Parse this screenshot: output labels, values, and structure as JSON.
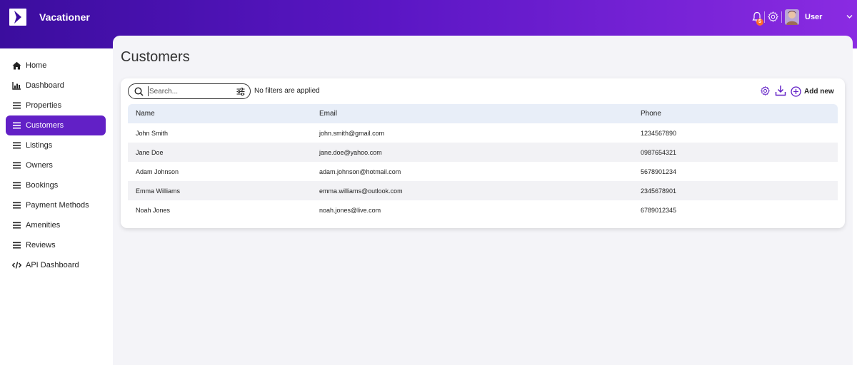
{
  "app": {
    "title": "Vacationer",
    "logo_icon": "chevron-right-logo"
  },
  "header": {
    "notification_count": "5",
    "user_name": "User",
    "accent": "#5a16c4"
  },
  "sidebar": {
    "items": [
      {
        "label": "Home",
        "icon": "home-icon",
        "active": false
      },
      {
        "label": "Dashboard",
        "icon": "bar-chart-icon",
        "active": false
      },
      {
        "label": "Properties",
        "icon": "list-icon",
        "active": false
      },
      {
        "label": "Customers",
        "icon": "list-icon",
        "active": true
      },
      {
        "label": "Listings",
        "icon": "list-icon",
        "active": false
      },
      {
        "label": "Owners",
        "icon": "list-icon",
        "active": false
      },
      {
        "label": "Bookings",
        "icon": "list-icon",
        "active": false
      },
      {
        "label": "Payment Methods",
        "icon": "list-icon",
        "active": false
      },
      {
        "label": "Amenities",
        "icon": "list-icon",
        "active": false
      },
      {
        "label": "Reviews",
        "icon": "list-icon",
        "active": false
      },
      {
        "label": "API Dashboard",
        "icon": "code-icon",
        "active": false
      }
    ]
  },
  "main": {
    "page_title": "Customers",
    "search": {
      "placeholder": "Search...",
      "value": ""
    },
    "filter_status": "No filters are applied",
    "add_new_label": "Add new",
    "table": {
      "columns": [
        "Name",
        "Email",
        "Phone"
      ],
      "rows": [
        {
          "name": "John Smith",
          "email": "john.smith@gmail.com",
          "phone": "1234567890"
        },
        {
          "name": "Jane Doe",
          "email": "jane.doe@yahoo.com",
          "phone": "0987654321"
        },
        {
          "name": "Adam Johnson",
          "email": "adam.johnson@hotmail.com",
          "phone": "5678901234"
        },
        {
          "name": "Emma Williams",
          "email": "emma.williams@outlook.com",
          "phone": "2345678901"
        },
        {
          "name": "Noah Jones",
          "email": "noah.jones@live.com",
          "phone": "6789012345"
        }
      ]
    }
  }
}
